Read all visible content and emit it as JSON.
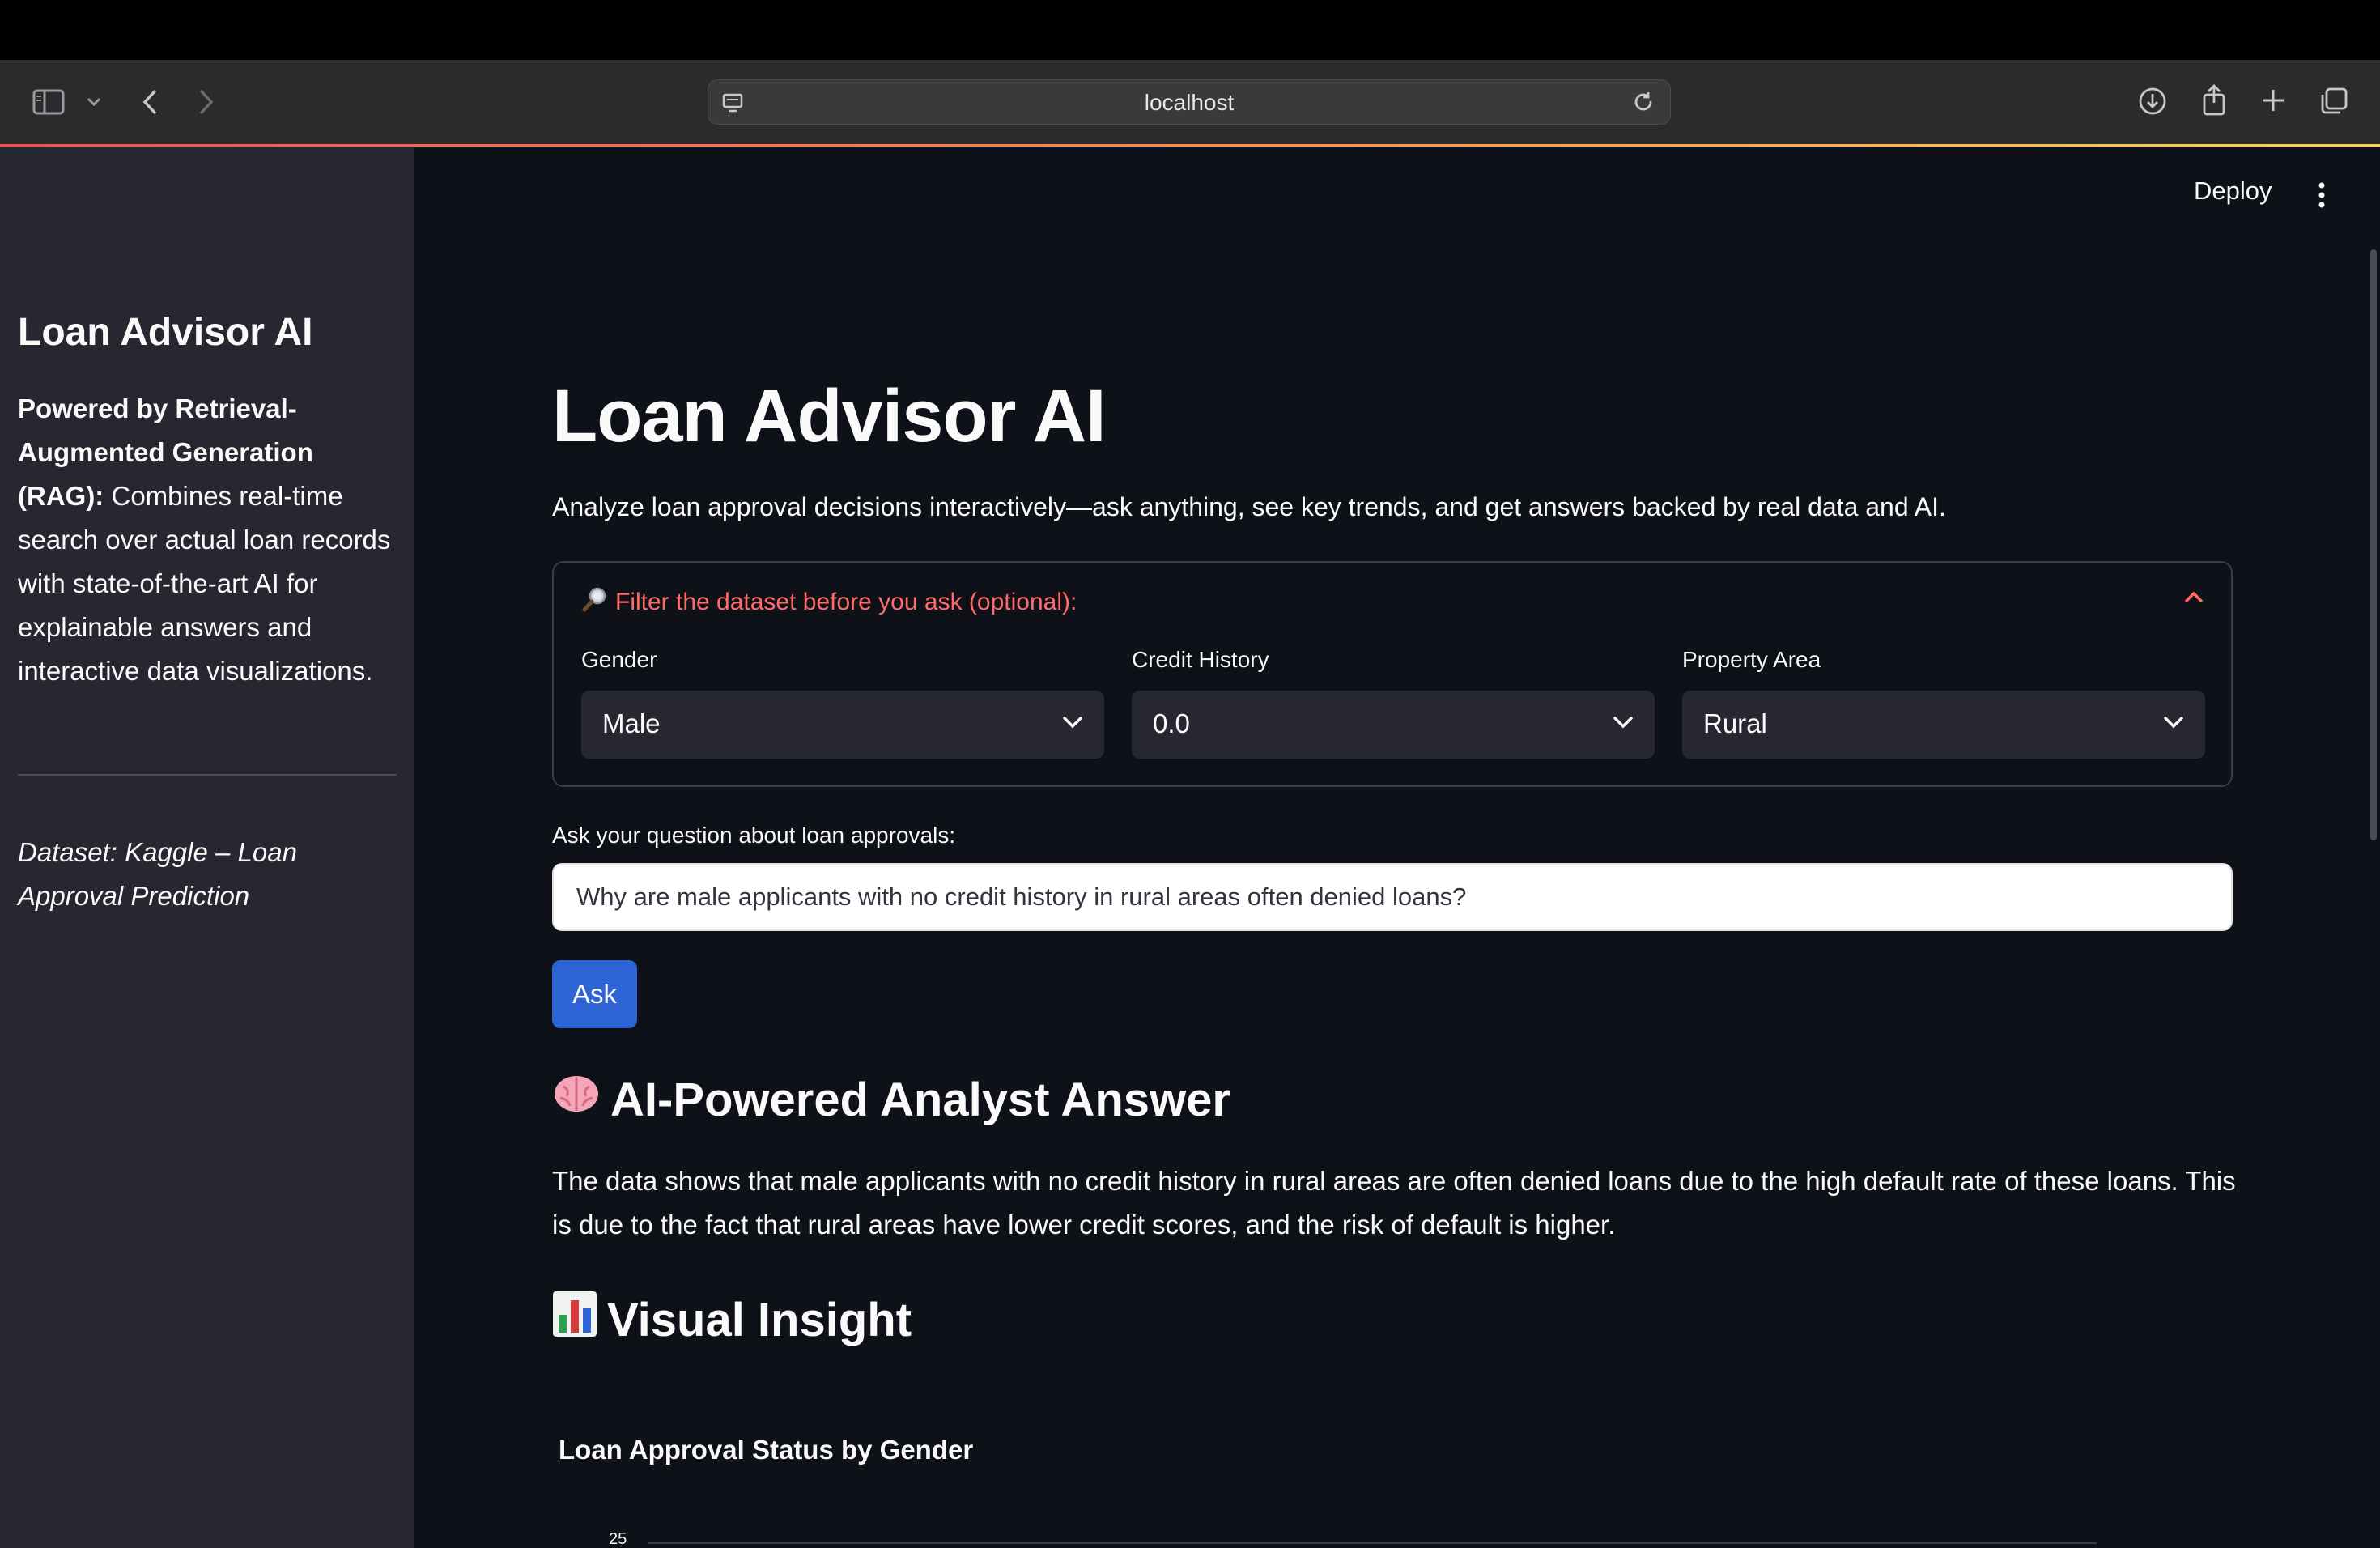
{
  "browser": {
    "address": "localhost",
    "icons": [
      "sidebar-icon",
      "chevron-down-icon",
      "back-icon",
      "forward-icon",
      "site-info-icon",
      "reload-icon",
      "download-icon",
      "share-icon",
      "new-tab-icon",
      "tabs-overview-icon"
    ]
  },
  "app": {
    "deploy_label": "Deploy"
  },
  "sidebar": {
    "title": "Loan Advisor AI",
    "desc_bold": "Powered by Retrieval-Augmented Generation (RAG):",
    "desc_rest": " Combines real-time search over actual loan records with state-of-the-art AI for explainable answers and interactive data visualizations.",
    "dataset": "Dataset: Kaggle – Loan Approval Prediction"
  },
  "main": {
    "title": "Loan Advisor AI",
    "intro": "Analyze loan approval decisions interactively—ask anything, see key trends, and get answers backed by real data and AI.",
    "filter": {
      "title": "Filter the dataset before you ask (optional):",
      "icon": "magnifier-icon",
      "fields": [
        {
          "label": "Gender",
          "value": "Male"
        },
        {
          "label": "Credit History",
          "value": "0.0"
        },
        {
          "label": "Property Area",
          "value": "Rural"
        }
      ]
    },
    "question_label": "Ask your question about loan approvals:",
    "question_value": "Why are male applicants with no credit history in rural areas often denied loans?",
    "ask_label": "Ask",
    "answer_heading": "AI-Powered Analyst Answer",
    "answer_text": "The data shows that male applicants with no credit history in rural areas are often denied loans due to the high default rate of these loans. This is due to the fact that rural areas have lower credit scores, and the risk of default is higher.",
    "visual_heading": "Visual Insight",
    "chart_title": "Loan Approval Status by Gender",
    "chart_first_tick": "25"
  },
  "colors": {
    "accent_red": "#ff6b6b",
    "button_blue": "#2e64d6",
    "sidebar_bg": "#262730",
    "main_bg": "#0e1117"
  }
}
